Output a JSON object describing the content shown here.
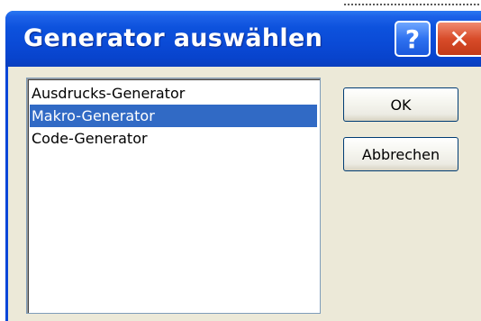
{
  "dialog": {
    "title": "Generator auswählen",
    "help_glyph": "?",
    "close_glyph": "✕"
  },
  "generators": {
    "items": [
      {
        "label": "Ausdrucks-Generator",
        "selected": false
      },
      {
        "label": "Makro-Generator",
        "selected": true
      },
      {
        "label": "Code-Generator",
        "selected": false
      }
    ]
  },
  "buttons": {
    "ok_label": "OK",
    "cancel_label": "Abbrechen"
  },
  "colors": {
    "titlebar": "#0a4ad6",
    "selection": "#316ac5",
    "close_button": "#d84c2a",
    "client_background": "#ece9d8"
  }
}
